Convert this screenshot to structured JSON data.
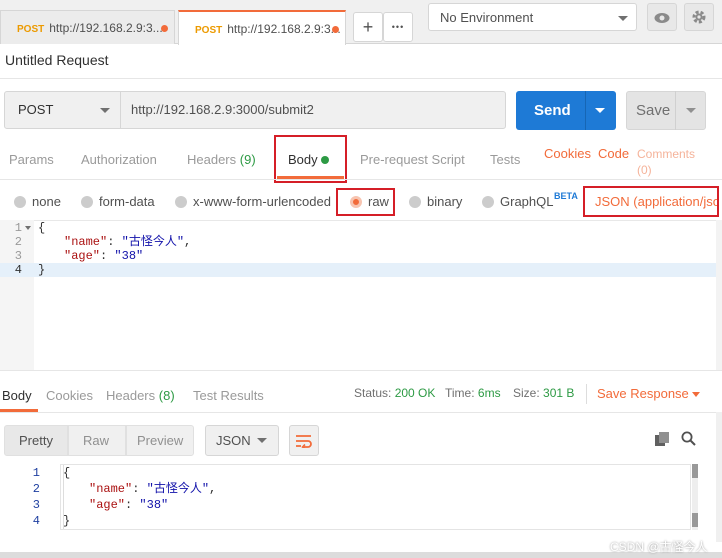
{
  "tabs": [
    {
      "method": "POST",
      "title": "http://192.168.2.9:3..."
    },
    {
      "method": "POST",
      "title": "http://192.168.2.9:3..."
    }
  ],
  "tab_actions": {
    "add": "+",
    "more": "•••"
  },
  "environment": {
    "selected": "No Environment"
  },
  "request": {
    "title": "Untitled Request",
    "method": "POST",
    "url": "http://192.168.2.9:3000/submit2",
    "send_label": "Send",
    "save_label": "Save"
  },
  "request_tabs": [
    {
      "label": "Params"
    },
    {
      "label": "Authorization"
    },
    {
      "label": "Headers",
      "count": "(9)"
    },
    {
      "label": "Body"
    },
    {
      "label": "Pre-request Script"
    },
    {
      "label": "Tests"
    }
  ],
  "request_links": {
    "cookies": "Cookies",
    "code": "Code",
    "comments": "Comments",
    "comments_count": "(0)"
  },
  "body_types": [
    "none",
    "form-data",
    "x-www-form-urlencoded",
    "raw",
    "binary",
    "GraphQL"
  ],
  "body_type_selected": "raw",
  "graphql_badge": "BETA",
  "content_type": "JSON (application/json)",
  "request_body": {
    "line_numbers": [
      "1",
      "2",
      "3",
      "4"
    ],
    "lines": [
      {
        "p1": "{"
      },
      {
        "key": "\"name\"",
        "sep": ": ",
        "val": "\"古怪今人\"",
        "end": ","
      },
      {
        "key": "\"age\"",
        "sep": ": ",
        "val": "\"38\"",
        "end": ""
      },
      {
        "p1": "}"
      }
    ]
  },
  "response_tabs": [
    {
      "label": "Body"
    },
    {
      "label": "Cookies"
    },
    {
      "label": "Headers",
      "count": "(8)"
    },
    {
      "label": "Test Results"
    }
  ],
  "response_status": {
    "status_label": "Status:",
    "status_value": "200 OK",
    "time_label": "Time:",
    "time_value": "6ms",
    "size_label": "Size:",
    "size_value": "301 B"
  },
  "save_response": "Save Response",
  "view_modes": [
    "Pretty",
    "Raw",
    "Preview"
  ],
  "response_format": "JSON",
  "response_body": {
    "line_numbers": [
      "1",
      "2",
      "3",
      "4"
    ],
    "lines": [
      {
        "p1": "{"
      },
      {
        "key": "\"name\"",
        "sep": ": ",
        "val": "\"古怪今人\"",
        "end": ","
      },
      {
        "key": "\"age\"",
        "sep": ": ",
        "val": "\"38\"",
        "end": ""
      },
      {
        "p1": "}"
      }
    ]
  },
  "watermark": "CSDN @古怪今人",
  "colors": {
    "accent": "#f26b3a",
    "send": "#1e7ad6",
    "success": "#2d9a44",
    "highlight": "#d51e27"
  }
}
